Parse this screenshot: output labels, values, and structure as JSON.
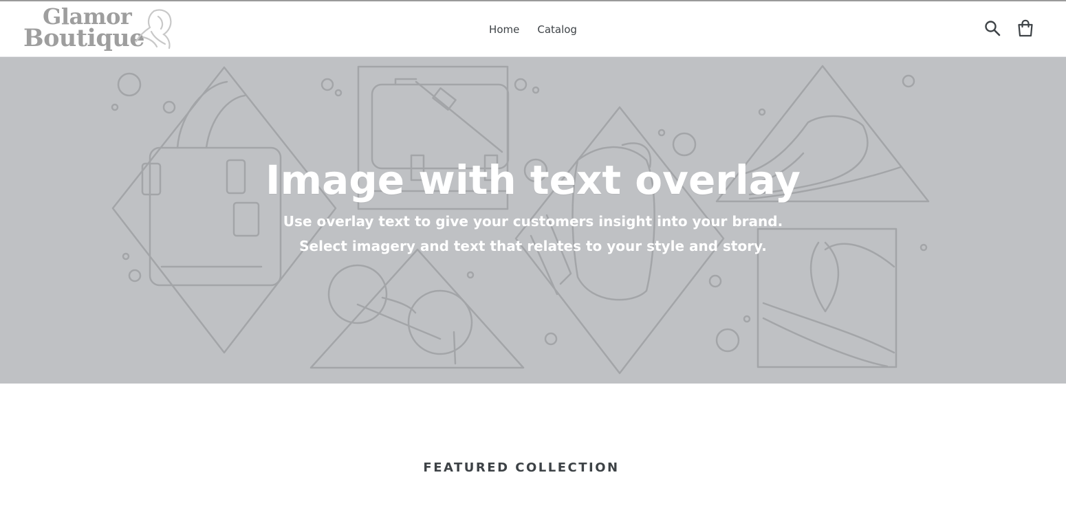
{
  "header": {
    "logo": {
      "line1": "Glamor",
      "line2": "Boutique"
    },
    "nav": [
      {
        "label": "Home"
      },
      {
        "label": "Catalog"
      }
    ],
    "icons": {
      "search": "search-icon",
      "cart": "cart-icon"
    }
  },
  "hero": {
    "title": "Image with text overlay",
    "subtitle_line1": "Use overlay text to give your customers insight into your brand.",
    "subtitle_line2": "Select imagery and text that relates to your style and story.",
    "background_color": "#bfc1c4",
    "line_art_color": "#a3a5a8"
  },
  "featured": {
    "title": "FEATURED COLLECTION"
  }
}
